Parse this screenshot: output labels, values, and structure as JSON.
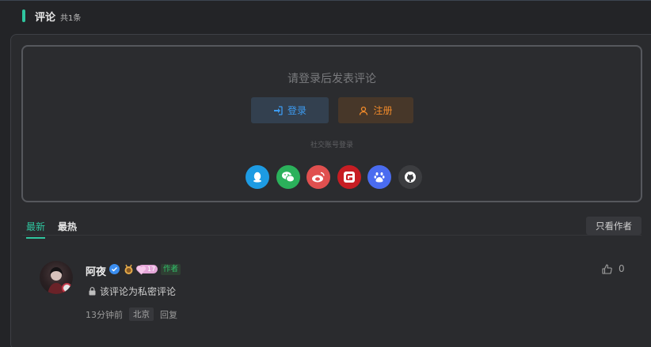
{
  "header": {
    "title": "评论",
    "count": "共1条"
  },
  "login": {
    "prompt": "请登录后发表评论",
    "login_label": "登录",
    "register_label": "注册",
    "social_label": "社交账号登录",
    "social": [
      {
        "name": "qq-icon",
        "color": "#1d9be3"
      },
      {
        "name": "wechat-icon",
        "color": "#2bb15b"
      },
      {
        "name": "weibo-icon",
        "color": "#e0504f"
      },
      {
        "name": "gitee-icon",
        "color": "#c71d23"
      },
      {
        "name": "baidu-icon",
        "color": "#4a6cf0"
      },
      {
        "name": "github-icon",
        "color": "#3c3d40"
      }
    ]
  },
  "tabs": {
    "latest": "最新",
    "hottest": "最热",
    "author_only": "只看作者"
  },
  "comment": {
    "username": "阿夜",
    "level": "17",
    "author_tag": "作者",
    "content": "该评论为私密评论",
    "time": "13分钟前",
    "location": "北京",
    "reply_label": "回复",
    "likes": "0"
  },
  "colors": {
    "accent": "#2fc59f",
    "login_blue": "#3d9bf0",
    "register_orange": "#f08a2a"
  }
}
